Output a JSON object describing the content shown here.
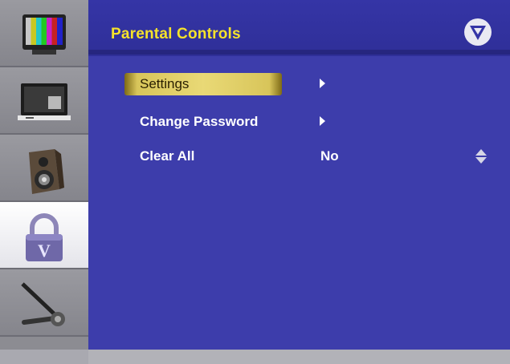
{
  "header": {
    "title": "Parental Controls",
    "logo_icon": "vizio-v-logo-icon"
  },
  "sidebar": {
    "items": [
      {
        "name": "picture",
        "icon": "tv-color-bars-icon",
        "active": false
      },
      {
        "name": "screen",
        "icon": "monitor-icon",
        "active": false
      },
      {
        "name": "audio",
        "icon": "speaker-icon",
        "active": false
      },
      {
        "name": "parental",
        "icon": "padlock-icon",
        "active": true
      },
      {
        "name": "setup",
        "icon": "wrench-icon",
        "active": false
      }
    ]
  },
  "menu": {
    "items": [
      {
        "label": "Settings",
        "value": "",
        "indicator": "arrow-right",
        "selected": true
      },
      {
        "label": "Change Password",
        "value": "",
        "indicator": "arrow-right",
        "selected": false
      },
      {
        "label": "Clear All",
        "value": "No",
        "indicator": "up-down",
        "selected": false
      }
    ]
  },
  "colors": {
    "background": "#3d3dab",
    "title": "#f5e22b",
    "highlight": "#e9d976",
    "text": "#ffffff"
  }
}
